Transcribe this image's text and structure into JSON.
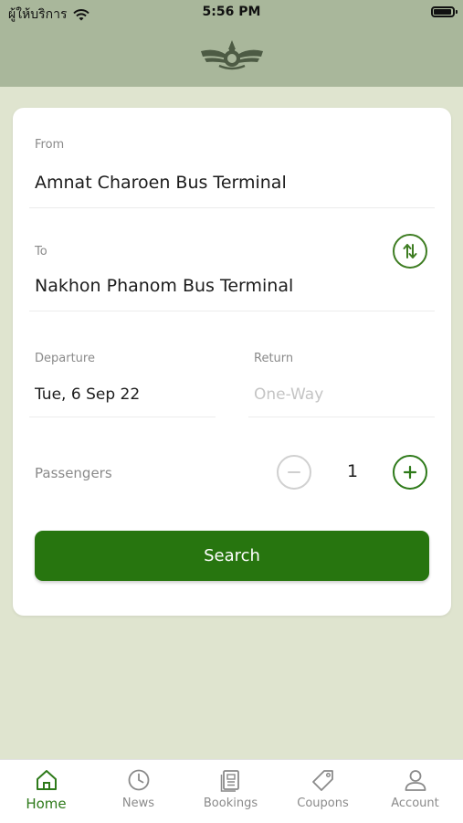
{
  "status_bar": {
    "carrier": "ผู้ให้บริการ",
    "time": "5:56 PM"
  },
  "form": {
    "from": {
      "label": "From",
      "value": "Amnat Charoen Bus Terminal"
    },
    "to": {
      "label": "To",
      "value": "Nakhon Phanom Bus Terminal"
    },
    "departure": {
      "label": "Departure",
      "value": "Tue, 6 Sep 22"
    },
    "return": {
      "label": "Return",
      "placeholder": "One-Way"
    },
    "passengers": {
      "label": "Passengers",
      "count": "1"
    },
    "search_label": "Search"
  },
  "tabs": [
    {
      "label": "Home",
      "icon": "home-icon",
      "active": true
    },
    {
      "label": "News",
      "icon": "clock-icon",
      "active": false
    },
    {
      "label": "Bookings",
      "icon": "bookings-icon",
      "active": false
    },
    {
      "label": "Coupons",
      "icon": "tag-icon",
      "active": false
    },
    {
      "label": "Account",
      "icon": "user-icon",
      "active": false
    }
  ],
  "colors": {
    "accent": "#27750f",
    "header": "#a9b79b",
    "background": "#dfe4cf",
    "inactive": "#8a8a8a"
  }
}
